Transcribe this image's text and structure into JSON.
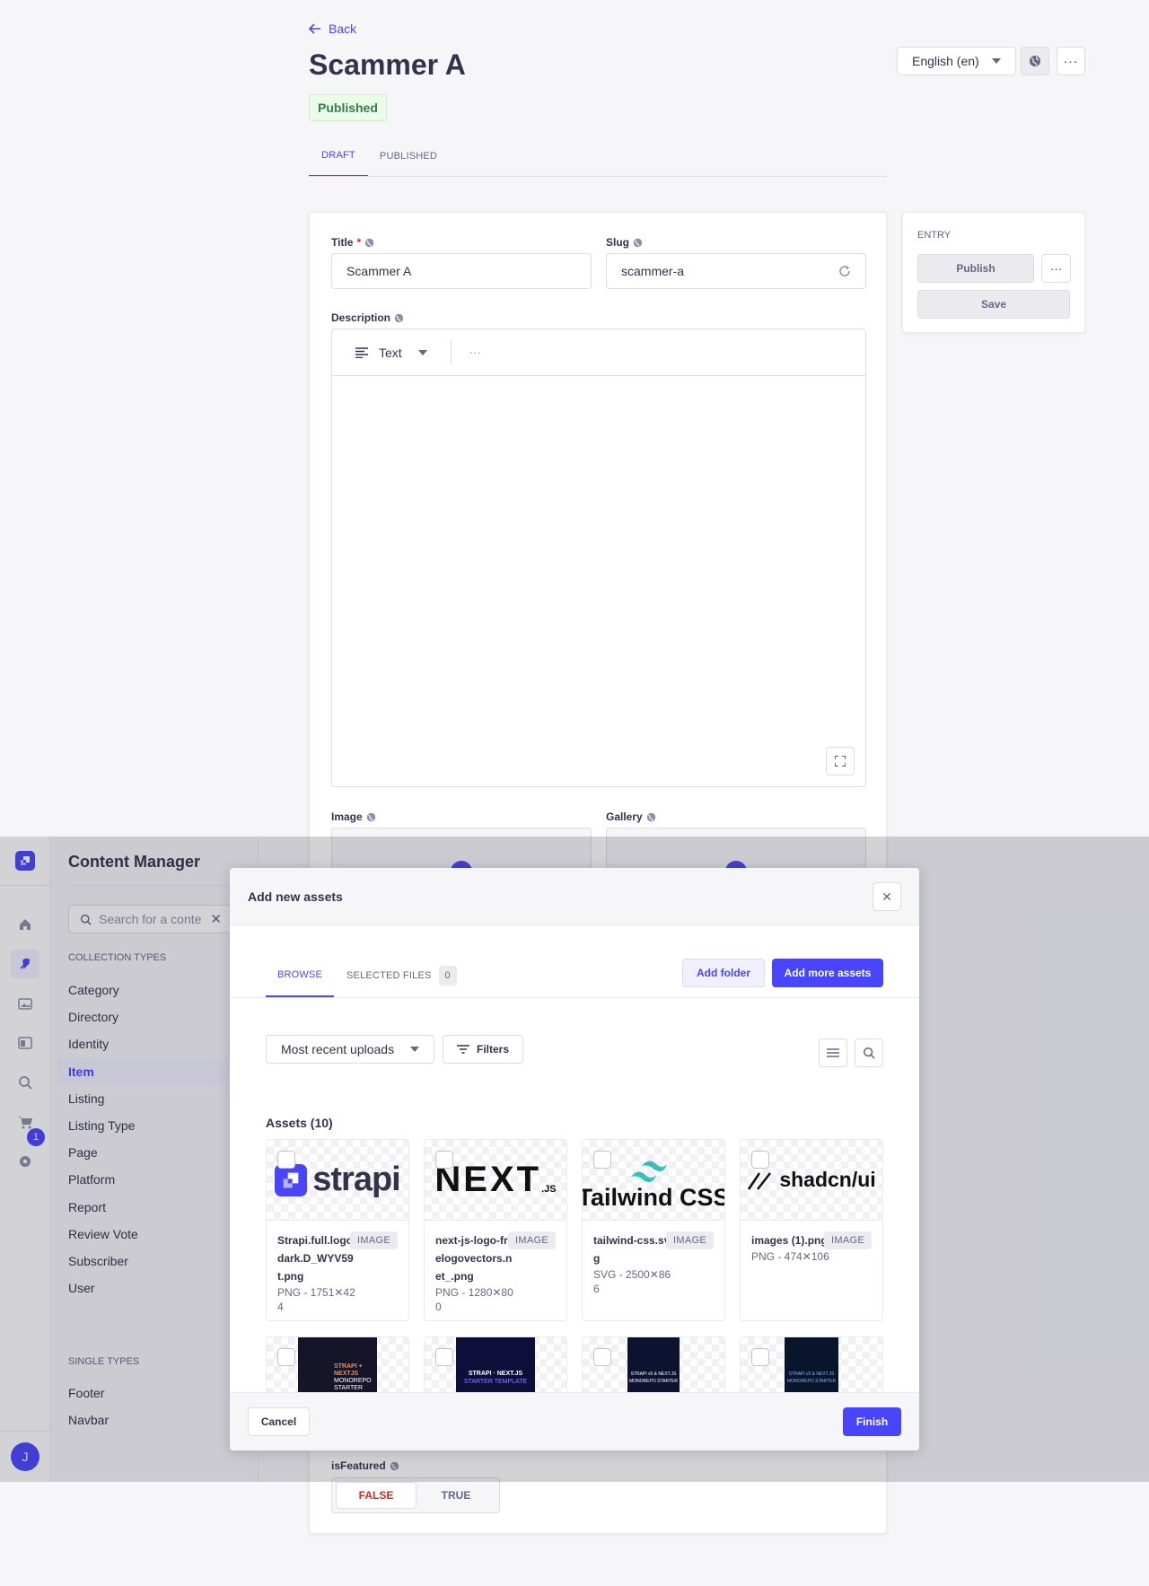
{
  "header": {
    "back_label": "Back",
    "title": "Scammer A",
    "status_badge": "Published",
    "locale": "English (en)"
  },
  "tabs": [
    {
      "label": "DRAFT"
    },
    {
      "label": "PUBLISHED"
    }
  ],
  "form": {
    "title_label": "Title",
    "title_required": "*",
    "title_value": "Scammer A",
    "slug_label": "Slug",
    "slug_value": "scammer-a",
    "description_label": "Description",
    "editor_mode": "Text",
    "editor_more": "···",
    "image_label": "Image",
    "gallery_label": "Gallery",
    "isfeatured_label": "isFeatured",
    "toggle_false": "FALSE",
    "toggle_true": "TRUE"
  },
  "entry_panel": {
    "heading": "ENTRY",
    "publish": "Publish",
    "save": "Save",
    "more": "···"
  },
  "sidebar": {
    "title": "Content Manager",
    "search_placeholder": "Search for a conte",
    "collection_heading": "COLLECTION TYPES",
    "collection_items": [
      "Category",
      "Directory",
      "Identity",
      "Item",
      "Listing",
      "Listing Type",
      "Page",
      "Platform",
      "Report",
      "Review Vote",
      "Subscriber",
      "User"
    ],
    "single_heading": "SINGLE TYPES",
    "single_items": [
      "Footer",
      "Navbar"
    ],
    "active_item": "Item",
    "notification_count": "1",
    "user_initial": "J"
  },
  "modal": {
    "title": "Add new assets",
    "tab_browse": "BROWSE",
    "tab_selected": "SELECTED FILES",
    "selected_count": "0",
    "add_folder": "Add folder",
    "add_more": "Add more assets",
    "sort_value": "Most recent uploads",
    "filters": "Filters",
    "assets_heading": "Assets (10)",
    "cancel": "Cancel",
    "finish": "Finish",
    "assets": [
      {
        "name": "Strapi.full.logo.dark.D_WYV59t.png",
        "type": "IMAGE",
        "meta": "PNG - 1751✕424",
        "logo": "strapi"
      },
      {
        "name": "next-js-logo-freelogovectors.net_.png",
        "type": "IMAGE",
        "meta": "PNG - 1280✕800",
        "logo": "NEXT",
        "logo_sub": ".JS"
      },
      {
        "name": "tailwind-css.svg",
        "type": "IMAGE",
        "meta": "SVG - 2500✕866",
        "logo": "Tailwind CSS"
      },
      {
        "name": "images (1).png",
        "type": "IMAGE",
        "meta": "PNG - 474✕106",
        "logo": "shadcn/ui"
      }
    ],
    "assets_row2": [
      {
        "lines": [
          "STRAPI +",
          "NEXTJS",
          "MONOREPO",
          "STARTER"
        ]
      },
      {
        "lines": [
          "STRAPI · NEXT.JS",
          "STARTER TEMPLATE"
        ]
      },
      {
        "lines": [
          "STRAPI v5 & NEXT.JS",
          "MONOREPO STARTER"
        ]
      },
      {
        "lines": [
          "STRAPI v5 & NEXT.JS",
          "MONOREPO STARTER"
        ]
      }
    ]
  },
  "colors": {
    "primary": "#4945ff",
    "bg": "#f6f6f9",
    "success_bg": "#eafbe7",
    "success_text": "#328048",
    "overlay": "rgba(220,220,228,0.6)"
  }
}
